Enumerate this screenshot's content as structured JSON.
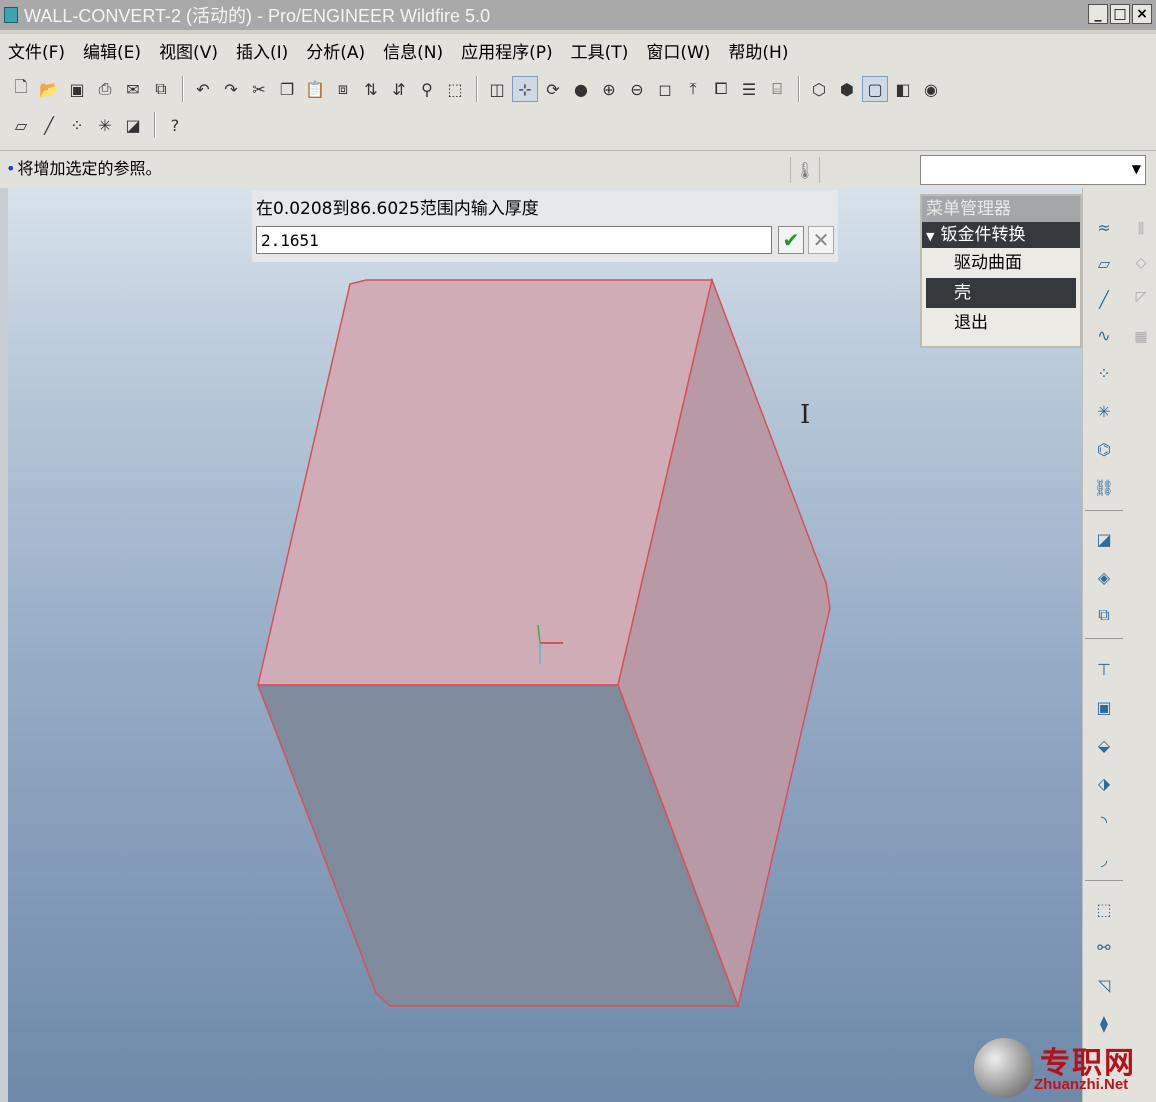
{
  "window": {
    "title": "WALL-CONVERT-2 (活动的) - Pro/ENGINEER Wildfire 5.0",
    "controls": [
      "_",
      "□",
      "×"
    ]
  },
  "menubar": {
    "items": [
      "文件(F)",
      "编辑(E)",
      "视图(V)",
      "插入(I)",
      "分析(A)",
      "信息(N)",
      "应用程序(P)",
      "工具(T)",
      "窗口(W)",
      "帮助(H)"
    ]
  },
  "toolbar": {
    "row1_icons": [
      "new-file-icon",
      "open-icon",
      "save-icon",
      "print-icon",
      "send-icon",
      "save-copy-icon",
      "undo-icon",
      "redo-icon",
      "cut-icon",
      "copy-icon",
      "paste-icon",
      "paste-special-icon",
      "regenerate-icon",
      "regen-manager-icon",
      "find-icon",
      "select-box-icon",
      "repaint-icon",
      "spin-center-icon",
      "orient-mode-icon",
      "shading-icon",
      "zoom-in-icon",
      "zoom-out-icon",
      "refit-icon",
      "reorient-icon",
      "saved-views-icon",
      "layers-icon",
      "view-manager-icon",
      "wireframe-icon",
      "hidden-line-icon",
      "no-hidden-icon",
      "shading-mode-icon",
      "enhanced-realism-icon"
    ],
    "row2_icons": [
      "datum-planes-icon",
      "datum-axes-icon",
      "datum-points-icon",
      "coordinate-systems-icon",
      "annotations-icon",
      "context-help-icon"
    ]
  },
  "status": {
    "message": "将增加选定的参照。",
    "filter_value": ""
  },
  "prompt": {
    "label": "在0.0208到86.6025范围内输入厚度",
    "input_value": "2.1651",
    "ok_symbol": "✔",
    "cancel_symbol": "✕"
  },
  "menu_manager": {
    "title": "菜单管理器",
    "submenu": "钣金件转换",
    "items": [
      {
        "label": "驱动曲面",
        "active": false
      },
      {
        "label": "壳",
        "active": true
      },
      {
        "label": "退出",
        "active": false
      }
    ]
  },
  "watermark": {
    "cn": "专职网",
    "en": "Zhuanzhi.Net"
  }
}
